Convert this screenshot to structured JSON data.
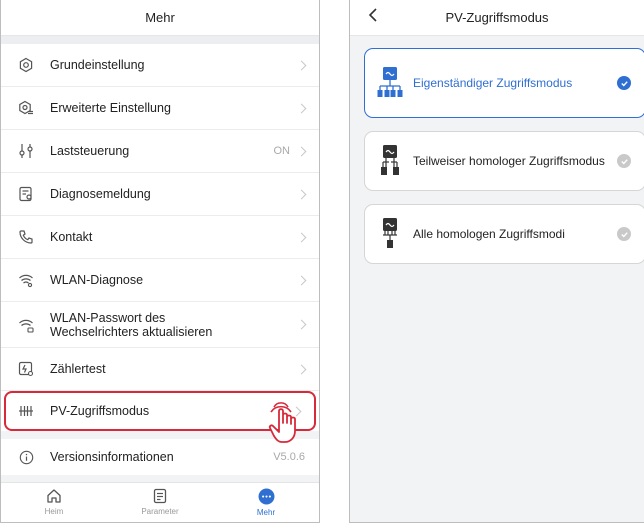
{
  "left": {
    "title": "Mehr",
    "menu": [
      {
        "label": "Grundeinstellung",
        "value": "",
        "icon": "settings-icon"
      },
      {
        "label": "Erweiterte Einstellung",
        "value": "",
        "icon": "advanced-settings-icon"
      },
      {
        "label": "Laststeuerung",
        "value": "ON",
        "icon": "load-control-icon"
      },
      {
        "label": "Diagnosemeldung",
        "value": "",
        "icon": "diagnosis-report-icon"
      },
      {
        "label": "Kontakt",
        "value": "",
        "icon": "phone-icon"
      },
      {
        "label": "WLAN-Diagnose",
        "value": "",
        "icon": "wifi-diagnosis-icon"
      },
      {
        "label": "WLAN-Passwort des\nWechselrichters aktualisieren",
        "value": "",
        "icon": "wifi-password-icon"
      },
      {
        "label": "Zählertest",
        "value": "",
        "icon": "meter-test-icon"
      },
      {
        "label": "PV-Zugriffsmodus",
        "value": "",
        "icon": "pv-access-mode-icon"
      }
    ],
    "version": {
      "label": "Versionsinformationen",
      "value": "V5.0.6"
    },
    "tabs": [
      {
        "label": "Heim",
        "icon": "home-icon"
      },
      {
        "label": "Parameter",
        "icon": "parameter-icon"
      },
      {
        "label": "Mehr",
        "icon": "more-icon"
      }
    ]
  },
  "right": {
    "title": "PV-Zugriffsmodus",
    "modes": [
      {
        "label": "Eigenständiger Zugriffsmodus",
        "selected": true
      },
      {
        "label": "Teilweiser homologer Zugriffsmodus",
        "selected": false
      },
      {
        "label": "Alle homologen Zugriffsmodi",
        "selected": false
      }
    ]
  },
  "colors": {
    "accent": "#2f6fd1",
    "highlight": "#d8293a",
    "hand": "#d8293a"
  }
}
